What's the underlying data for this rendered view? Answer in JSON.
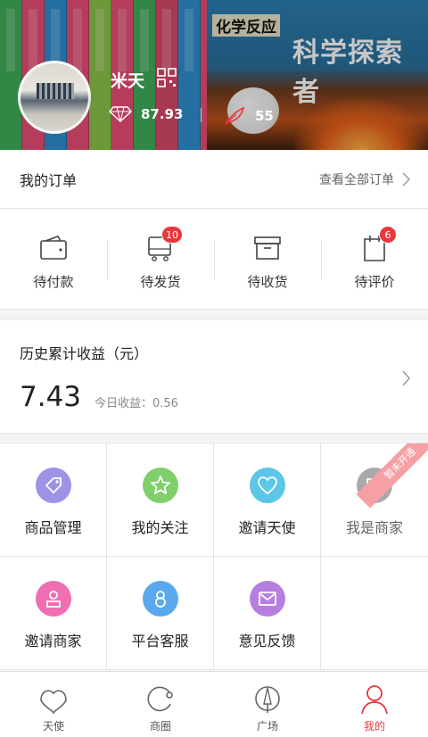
{
  "header": {
    "username": "米天",
    "diamond_value": "87.93",
    "feather_value": "55",
    "cover_series_title": "科学探索者",
    "cover_book_title": "化学反应"
  },
  "orders": {
    "title": "我的订单",
    "view_all": "查看全部订单",
    "items": [
      {
        "label": "待付款",
        "icon": "wallet-icon",
        "badge": ""
      },
      {
        "label": "待发货",
        "icon": "delivery-cart-icon",
        "badge": "10"
      },
      {
        "label": "待收货",
        "icon": "box-icon",
        "badge": ""
      },
      {
        "label": "待评价",
        "icon": "note-icon",
        "badge": "6"
      }
    ]
  },
  "income": {
    "title": "历史累计收益（元）",
    "total": "7.43",
    "today_label": "今日收益：0.56"
  },
  "features": {
    "items": [
      {
        "label": "商品管理",
        "icon": "tag-icon",
        "color": "#9d93e6"
      },
      {
        "label": "我的关注",
        "icon": "star-icon",
        "color": "#7fd06a"
      },
      {
        "label": "邀请天使",
        "icon": "heart-icon",
        "color": "#5cc6e6"
      },
      {
        "label": "我是商家",
        "icon": "store-icon",
        "color": "#a9a9a9",
        "ribbon": "暂未开通"
      },
      {
        "label": "邀请商家",
        "icon": "merchant-icon",
        "color": "#f06eb2"
      },
      {
        "label": "平台客服",
        "icon": "headset-icon",
        "color": "#5aa9ee"
      },
      {
        "label": "意见反馈",
        "icon": "mail-icon",
        "color": "#b77ee0"
      }
    ]
  },
  "tabbar": {
    "items": [
      {
        "label": "天使",
        "icon": "angel-wing-icon",
        "active": false
      },
      {
        "label": "商圈",
        "icon": "circle-icon",
        "active": false
      },
      {
        "label": "广场",
        "icon": "plaza-icon",
        "active": false
      },
      {
        "label": "我的",
        "icon": "profile-icon",
        "active": true
      }
    ]
  },
  "colors": {
    "accent": "#e8383d",
    "badge": "#e8383d"
  }
}
